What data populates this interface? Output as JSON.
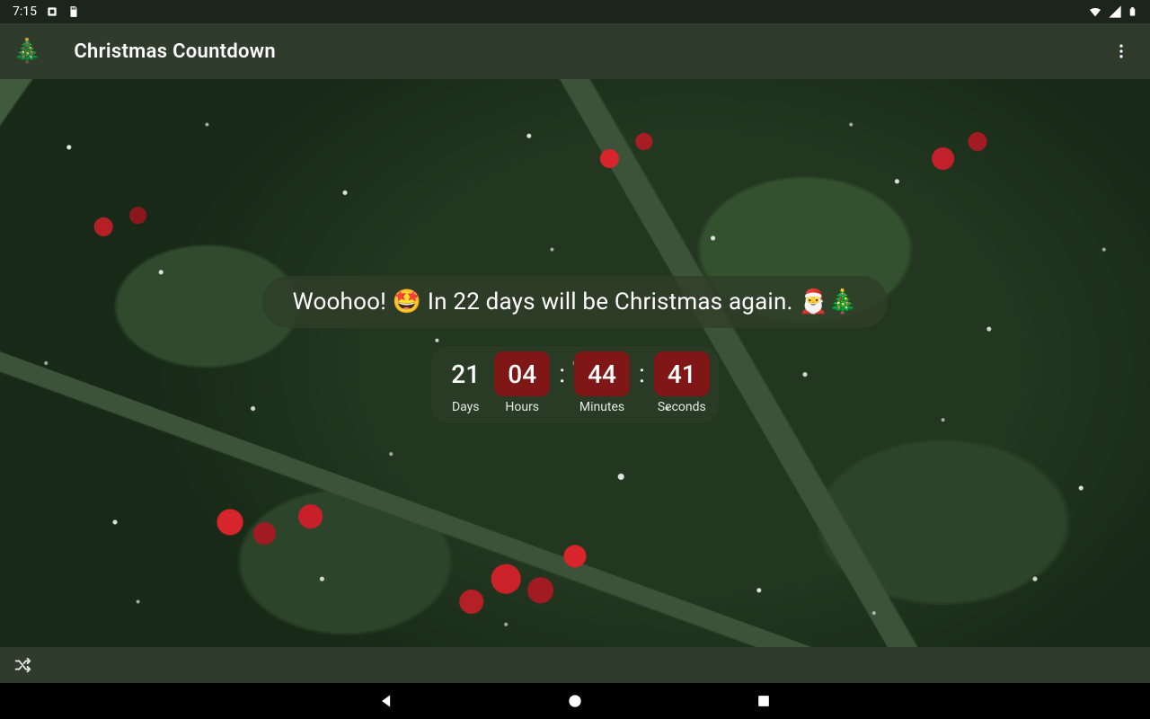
{
  "statusbar": {
    "time": "7:15",
    "left_icons": [
      "app-notification-icon",
      "memory-card-icon"
    ],
    "right_icons": [
      "wifi-icon",
      "cell-signal-icon",
      "battery-icon"
    ]
  },
  "appbar": {
    "title": "Christmas Countdown",
    "logo_emoji": "🎄"
  },
  "message": {
    "text": "Woohoo! 🤩 In 22 days will be Christmas again. 🎅🎄"
  },
  "countdown": {
    "days": {
      "value": "21",
      "label": "Days"
    },
    "hours": {
      "value": "04",
      "label": "Hours"
    },
    "minutes": {
      "value": "44",
      "label": "Minutes"
    },
    "seconds": {
      "value": "41",
      "label": "Seconds"
    },
    "separator": ":"
  },
  "bottombar": {
    "shuffle_icon": "shuffle-icon"
  },
  "colors": {
    "appbar_bg": "#2f3b2b",
    "statusbar_bg": "#1b251b",
    "counter_red": "#7e1716"
  }
}
